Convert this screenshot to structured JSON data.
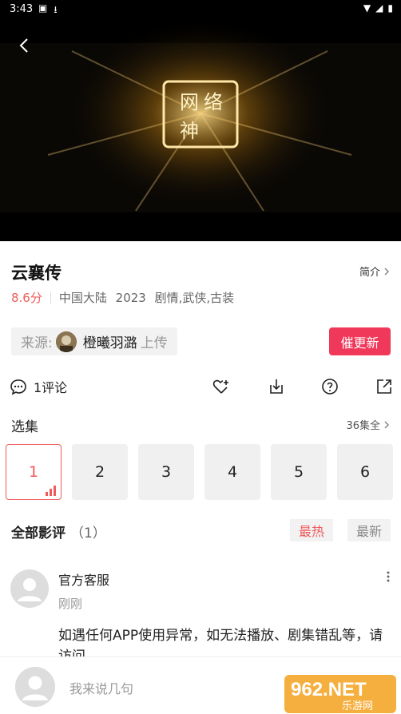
{
  "status_bar": {
    "time": "3:43"
  },
  "video": {
    "logo_text": "网络神"
  },
  "show": {
    "title": "云襄传",
    "intro_label": "简介",
    "score": "8.6分",
    "region": "中国大陆",
    "year": "2023",
    "genres": "剧情,武侠,古装"
  },
  "source": {
    "label": "来源:",
    "uploader": "橙曦羽潞",
    "upload_suffix": "上传",
    "update_button": "催更新"
  },
  "actions": {
    "comment_count": "1评论",
    "icons": [
      "heart-plus-icon",
      "download-icon",
      "help-icon",
      "share-icon"
    ]
  },
  "episodes": {
    "title": "选集",
    "all_label": "36集全",
    "items": [
      "1",
      "2",
      "3",
      "4",
      "5",
      "6"
    ],
    "active": "1"
  },
  "reviews": {
    "title": "全部影评",
    "count": "（1）",
    "sort_hot": "最热",
    "sort_new": "最新",
    "items": [
      {
        "author": "官方客服",
        "time": "刚刚",
        "content": "如遇任何APP使用异常，如无法播放、剧集错乱等，请访问"
      }
    ]
  },
  "input": {
    "placeholder": "我来说几句"
  },
  "watermark": {
    "text": "962.NET",
    "subtext": "乐游网"
  },
  "colors": {
    "accent": "#f0385a",
    "score": "#f05a5a"
  }
}
